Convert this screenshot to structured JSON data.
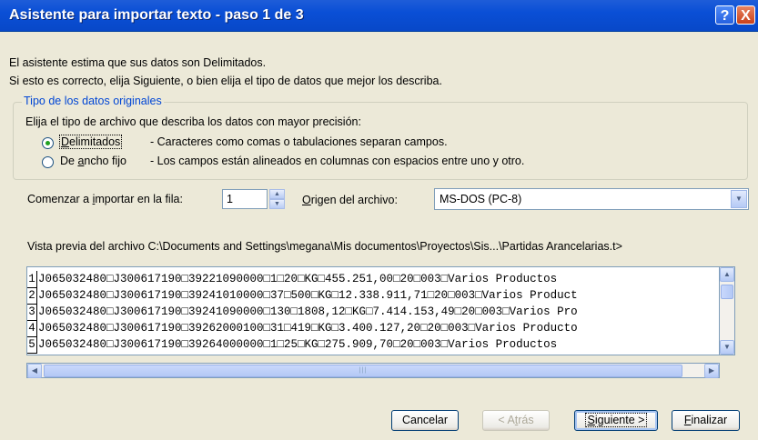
{
  "window": {
    "title": "Asistente para importar texto - paso 1 de 3",
    "help_icon": "?",
    "close_icon": "X"
  },
  "intro": {
    "line1": "El asistente estima que sus datos son Delimitados.",
    "line2": "Si esto es correcto, elija Siguiente, o bien elija el tipo de datos que mejor los describa."
  },
  "group": {
    "legend": "Tipo de los datos originales",
    "prompt": "Elija el tipo de archivo que describa los datos con mayor precisión:",
    "options": [
      {
        "label_pre": "",
        "label_key": "D",
        "label_post": "elimitados",
        "description": "- Caracteres como comas o tabulaciones separan campos.",
        "checked": true
      },
      {
        "label_pre": "De ",
        "label_key": "a",
        "label_post": "ncho fijo",
        "description": "- Los campos están alineados en columnas con espacios entre uno y otro.",
        "checked": false
      }
    ]
  },
  "import_row": {
    "label_pre": "Comenzar a ",
    "label_key": "i",
    "label_post": "mportar en la fila:",
    "value": "1"
  },
  "origin": {
    "label_pre": "",
    "label_key": "O",
    "label_post": "rigen del archivo:",
    "value": "MS-DOS (PC-8)"
  },
  "preview": {
    "label": "Vista previa del archivo C:\\Documents and Settings\\megana\\Mis documentos\\Proyectos\\Sis...\\Partidas Arancelarias.t>",
    "rows": [
      {
        "num": "1",
        "text": "J065032480□J300617190□39221090000□1□20□KG□455.251,00□20□003□Varios Productos"
      },
      {
        "num": "2",
        "text": "J065032480□J300617190□39241010000□37□500□KG□12.338.911,71□20□003□Varios Product"
      },
      {
        "num": "3",
        "text": "J065032480□J300617190□39241090000□130□1808,12□KG□7.414.153,49□20□003□Varios Pro"
      },
      {
        "num": "4",
        "text": "J065032480□J300617190□39262000100□31□419□KG□3.400.127,20□20□003□Varios Producto"
      },
      {
        "num": "5",
        "text": "J065032480□J300617190□39264000000□1□25□KG□275.909,70□20□003□Varios Productos"
      }
    ]
  },
  "buttons": {
    "cancel": {
      "pre": "",
      "key": "",
      "post": "Cancelar"
    },
    "back": {
      "pre": "< A",
      "key": "t",
      "post": "rás"
    },
    "next": {
      "pre": "",
      "key": "S",
      "post": "iguiente >"
    },
    "finish": {
      "pre": "",
      "key": "F",
      "post": "inalizar"
    }
  },
  "icons": {
    "up_arrow": "▲",
    "down_arrow": "▼",
    "left_arrow": "◀",
    "right_arrow": "▶",
    "grip": "|||"
  }
}
